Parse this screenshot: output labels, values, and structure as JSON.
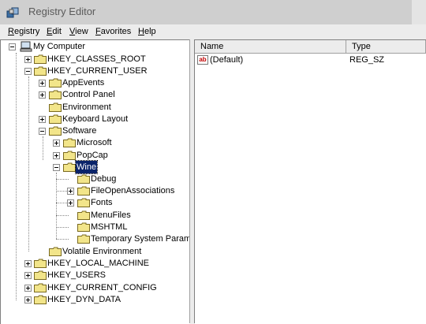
{
  "window": {
    "title": "Registry Editor"
  },
  "menu": [
    "Registry",
    "Edit",
    "View",
    "Favorites",
    "Help"
  ],
  "menu_underline": [
    "R",
    "E",
    "V",
    "F",
    "H"
  ],
  "tree": {
    "root": "My Computer",
    "hkcr": "HKEY_CLASSES_ROOT",
    "hkcu": "HKEY_CURRENT_USER",
    "appevents": "AppEvents",
    "control_panel": "Control Panel",
    "environment": "Environment",
    "keyboard_layout": "Keyboard Layout",
    "software": "Software",
    "microsoft": "Microsoft",
    "popcap": "PopCap",
    "wine": "Wine",
    "debug": "Debug",
    "fileopen": "FileOpenAssociations",
    "fonts": "Fonts",
    "menufiles": "MenuFiles",
    "mshtml": "MSHTML",
    "temp_params": "Temporary System Paramet",
    "volatile": "Volatile Environment",
    "hklm": "HKEY_LOCAL_MACHINE",
    "hku": "HKEY_USERS",
    "hkcc": "HKEY_CURRENT_CONFIG",
    "hkdd": "HKEY_DYN_DATA"
  },
  "list": {
    "columns": {
      "name": "Name",
      "type": "Type"
    },
    "rows": [
      {
        "name": "(Default)",
        "type": "REG_SZ",
        "icon": "ab"
      }
    ]
  },
  "colors": {
    "selection": "#0a246a",
    "folder": "#f2e58a"
  }
}
